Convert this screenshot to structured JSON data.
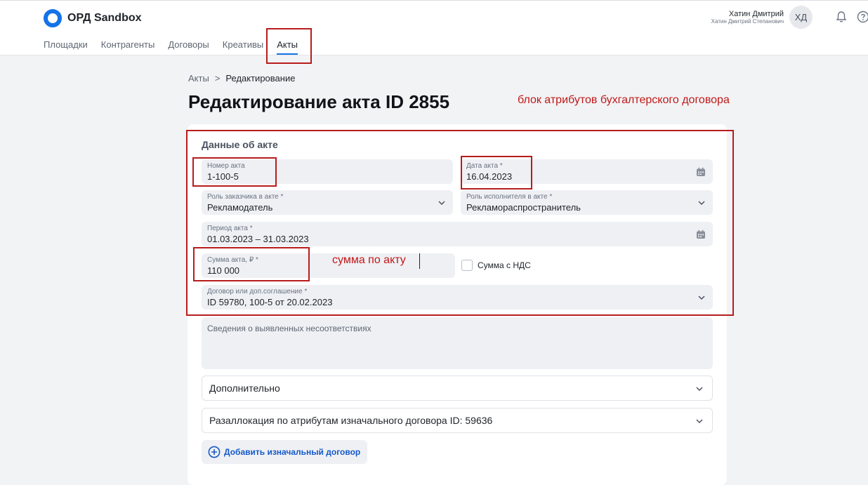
{
  "app": {
    "name": "ОРД Sandbox",
    "user_name": "Хатин Дмитрий",
    "user_full_name": "Хатин Дмитрий Степанович",
    "user_initials": "ХД",
    "accent": "#1473e6"
  },
  "nav": {
    "items": [
      {
        "label": "Площадки"
      },
      {
        "label": "Контрагенты"
      },
      {
        "label": "Договоры"
      },
      {
        "label": "Креативы"
      },
      {
        "label": "Акты",
        "active": true
      }
    ]
  },
  "breadcrumb": {
    "parent": "Акты",
    "separator": ">",
    "current": "Редактирование"
  },
  "page": {
    "title": "Редактирование акта ID 2855"
  },
  "annotations": {
    "block": "блок атрибутов бухгалтерского договора",
    "sum": "сумма по акту",
    "color": "#c01818"
  },
  "form": {
    "section_title": "Данные об акте",
    "act_number": {
      "label": "Номер акта",
      "value": "1-100-5"
    },
    "act_date": {
      "label": "Дата акта *",
      "value": "16.04.2023",
      "icon": "calendar-icon"
    },
    "customer_role": {
      "label": "Роль заказчика в акте *",
      "value": "Рекламодатель"
    },
    "executor_role": {
      "label": "Роль исполнителя в акте *",
      "value": "Рекламораспространитель"
    },
    "period": {
      "label": "Период акта *",
      "value": "01.03.2023 – 31.03.2023",
      "icon": "calendar-icon"
    },
    "amount": {
      "label": "Сумма акта, ₽ *",
      "value": "110 000"
    },
    "vat": {
      "label": "Сумма с НДС",
      "checked": false
    },
    "contract": {
      "label": "Договор или доп.соглашение *",
      "value": "ID 59780, 100-5 от 20.02.2023"
    },
    "discrepancies": {
      "placeholder": "Сведения о выявленных несоответствиях"
    },
    "additional": {
      "label": "Дополнительно"
    },
    "reallocation": {
      "label": "Разаллокация по атрибутам изначального договора ID: 59636"
    },
    "add_contract": {
      "label": "Добавить изначальный договор"
    }
  }
}
